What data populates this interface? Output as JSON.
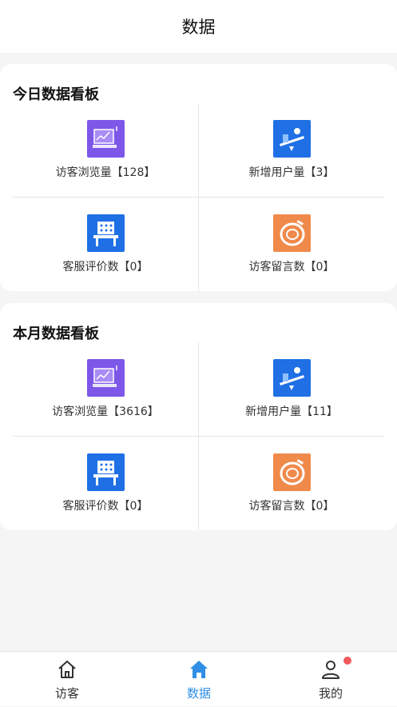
{
  "header": {
    "title": "数据"
  },
  "today": {
    "title": "今日数据看板",
    "cells": [
      {
        "label": "访客浏览量【128】",
        "icon": "chart-monitor-icon",
        "color": "#7d57e8"
      },
      {
        "label": "新增用户量【3】",
        "icon": "seesaw-user-icon",
        "color": "#1f6fe5"
      },
      {
        "label": "客服评价数【0】",
        "icon": "service-table-icon",
        "color": "#1f6fe5"
      },
      {
        "label": "访客留言数【0】",
        "icon": "message-disc-icon",
        "color": "#f08a4b"
      }
    ]
  },
  "month": {
    "title": "本月数据看板",
    "cells": [
      {
        "label": "访客浏览量【3616】",
        "icon": "chart-monitor-icon",
        "color": "#7d57e8"
      },
      {
        "label": "新增用户量【11】",
        "icon": "seesaw-user-icon",
        "color": "#1f6fe5"
      },
      {
        "label": "客服评价数【0】",
        "icon": "service-table-icon",
        "color": "#1f6fe5"
      },
      {
        "label": "访客留言数【0】",
        "icon": "message-disc-icon",
        "color": "#f08a4b"
      }
    ]
  },
  "tabbar": {
    "tabs": [
      {
        "label": "访客",
        "icon": "home-outline-icon",
        "active": false
      },
      {
        "label": "数据",
        "icon": "home-filled-icon",
        "active": true
      },
      {
        "label": "我的",
        "icon": "user-icon",
        "active": false,
        "badge": true
      }
    ],
    "active_color": "#2f8fe6",
    "badge_color": "#f05a5a"
  }
}
